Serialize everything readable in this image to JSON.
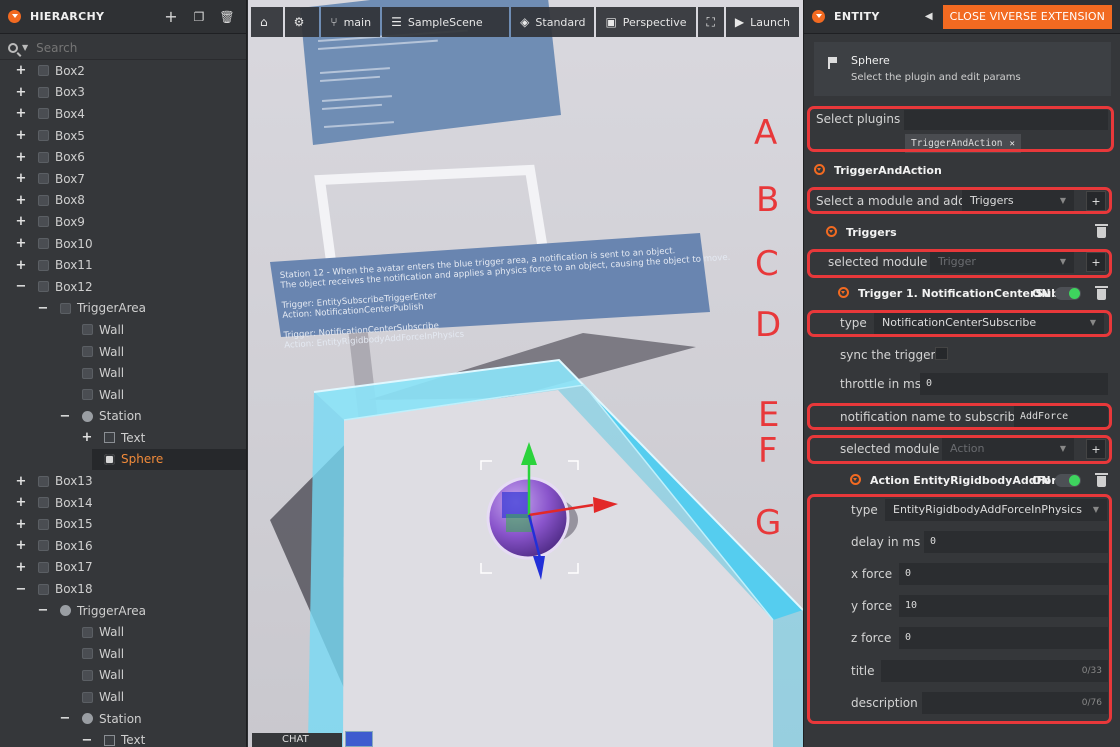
{
  "hierarchy": {
    "title": "HIERARCHY",
    "search_placeholder": "Search",
    "rows": [
      {
        "label": "Box2",
        "depth": 0,
        "exp": "+",
        "icon": "cube"
      },
      {
        "label": "Box3",
        "depth": 0,
        "exp": "+",
        "icon": "cube"
      },
      {
        "label": "Box4",
        "depth": 0,
        "exp": "+",
        "icon": "cube"
      },
      {
        "label": "Box5",
        "depth": 0,
        "exp": "+",
        "icon": "cube"
      },
      {
        "label": "Box6",
        "depth": 0,
        "exp": "+",
        "icon": "cube"
      },
      {
        "label": "Box7",
        "depth": 0,
        "exp": "+",
        "icon": "cube"
      },
      {
        "label": "Box8",
        "depth": 0,
        "exp": "+",
        "icon": "cube"
      },
      {
        "label": "Box9",
        "depth": 0,
        "exp": "+",
        "icon": "cube"
      },
      {
        "label": "Box10",
        "depth": 0,
        "exp": "+",
        "icon": "cube"
      },
      {
        "label": "Box11",
        "depth": 0,
        "exp": "+",
        "icon": "cube"
      },
      {
        "label": "Box12",
        "depth": 0,
        "exp": "−",
        "icon": "cube"
      },
      {
        "label": "TriggerArea",
        "depth": 1,
        "exp": "−",
        "icon": "cube"
      },
      {
        "label": "Wall",
        "depth": 2,
        "exp": "",
        "icon": "cube"
      },
      {
        "label": "Wall",
        "depth": 2,
        "exp": "",
        "icon": "cube"
      },
      {
        "label": "Wall",
        "depth": 2,
        "exp": "",
        "icon": "cube"
      },
      {
        "label": "Wall",
        "depth": 2,
        "exp": "",
        "icon": "cube"
      },
      {
        "label": "Station",
        "depth": 2,
        "exp": "−",
        "icon": "circle"
      },
      {
        "label": "Text",
        "depth": 3,
        "exp": "+",
        "icon": "text"
      },
      {
        "label": "Sphere",
        "depth": 3,
        "exp": "",
        "icon": "sphere",
        "selected": true
      },
      {
        "label": "Box13",
        "depth": 0,
        "exp": "+",
        "icon": "cube"
      },
      {
        "label": "Box14",
        "depth": 0,
        "exp": "+",
        "icon": "cube"
      },
      {
        "label": "Box15",
        "depth": 0,
        "exp": "+",
        "icon": "cube"
      },
      {
        "label": "Box16",
        "depth": 0,
        "exp": "+",
        "icon": "cube"
      },
      {
        "label": "Box17",
        "depth": 0,
        "exp": "+",
        "icon": "cube"
      },
      {
        "label": "Box18",
        "depth": 0,
        "exp": "−",
        "icon": "cube"
      },
      {
        "label": "TriggerArea",
        "depth": 1,
        "exp": "−",
        "icon": "circle"
      },
      {
        "label": "Wall",
        "depth": 2,
        "exp": "",
        "icon": "cube"
      },
      {
        "label": "Wall",
        "depth": 2,
        "exp": "",
        "icon": "cube"
      },
      {
        "label": "Wall",
        "depth": 2,
        "exp": "",
        "icon": "cube"
      },
      {
        "label": "Wall",
        "depth": 2,
        "exp": "",
        "icon": "cube"
      },
      {
        "label": "Station",
        "depth": 2,
        "exp": "−",
        "icon": "circle"
      },
      {
        "label": "Text",
        "depth": 3,
        "exp": "−",
        "icon": "text"
      }
    ]
  },
  "toolbar": {
    "branch": "main",
    "scene": "SampleScene",
    "shading": "Standard",
    "camera": "Perspective",
    "launch": "Launch"
  },
  "viewport": {
    "sign_text": [
      "Station 12 - When the avatar enters the blue trigger area, a notification is sent to an object.",
      "The object receives the notification and applies a physics force to an object, causing the object to move.",
      "",
      "Trigger: EntitySubscribeTriggerEnter",
      "Action: NotificationCenterPublish",
      "",
      "Trigger: NotificationCenterSubscribe",
      "Action: EntityRigidbodyAddForceInPhysics"
    ],
    "chat_label": "CHAT"
  },
  "entity": {
    "title": "ENTITY",
    "close_label": "CLOSE VIVERSE EXTENSION",
    "selected_name": "Sphere",
    "selected_hint": "Select the plugin and edit params",
    "select_plugins_label": "Select plugins",
    "plugin_chip": "TriggerAndAction",
    "plugin_title": "TriggerAndAction",
    "module_add_label": "Select a module and add",
    "module_add_value": "Triggers",
    "triggers_title": "Triggers",
    "selected_module_label": "selected module",
    "trigger_module_placeholder": "Trigger",
    "trigger_title": "Trigger 1. NotificationCenterSub...",
    "on_label": "ON",
    "type_label": "type",
    "trigger_type": "NotificationCenterSubscribe",
    "sync_label": "sync the trigger",
    "throttle_label": "throttle in ms",
    "throttle_value": "0",
    "notification_label": "notification name to subscribe",
    "notification_value": "AddForce",
    "action_module_placeholder": "Action",
    "action_title": "Action EntityRigidbodyAddFor...",
    "action_type": "EntityRigidbodyAddForceInPhysics",
    "delay_label": "delay in ms",
    "delay_value": "0",
    "xforce_label": "x force",
    "xforce_value": "0",
    "yforce_label": "y force",
    "yforce_value": "10",
    "zforce_label": "z force",
    "zforce_value": "0",
    "title_label": "title",
    "title_counter": "0/33",
    "description_label": "description",
    "description_counter": "0/76"
  },
  "annotations": [
    "A",
    "B",
    "C",
    "D",
    "E",
    "F",
    "G"
  ],
  "colors": {
    "accent": "#f26a21",
    "annotation_red": "#e8383a",
    "trigger_cyan": "#5ad8f5",
    "toggle_green": "#3ed35e"
  }
}
